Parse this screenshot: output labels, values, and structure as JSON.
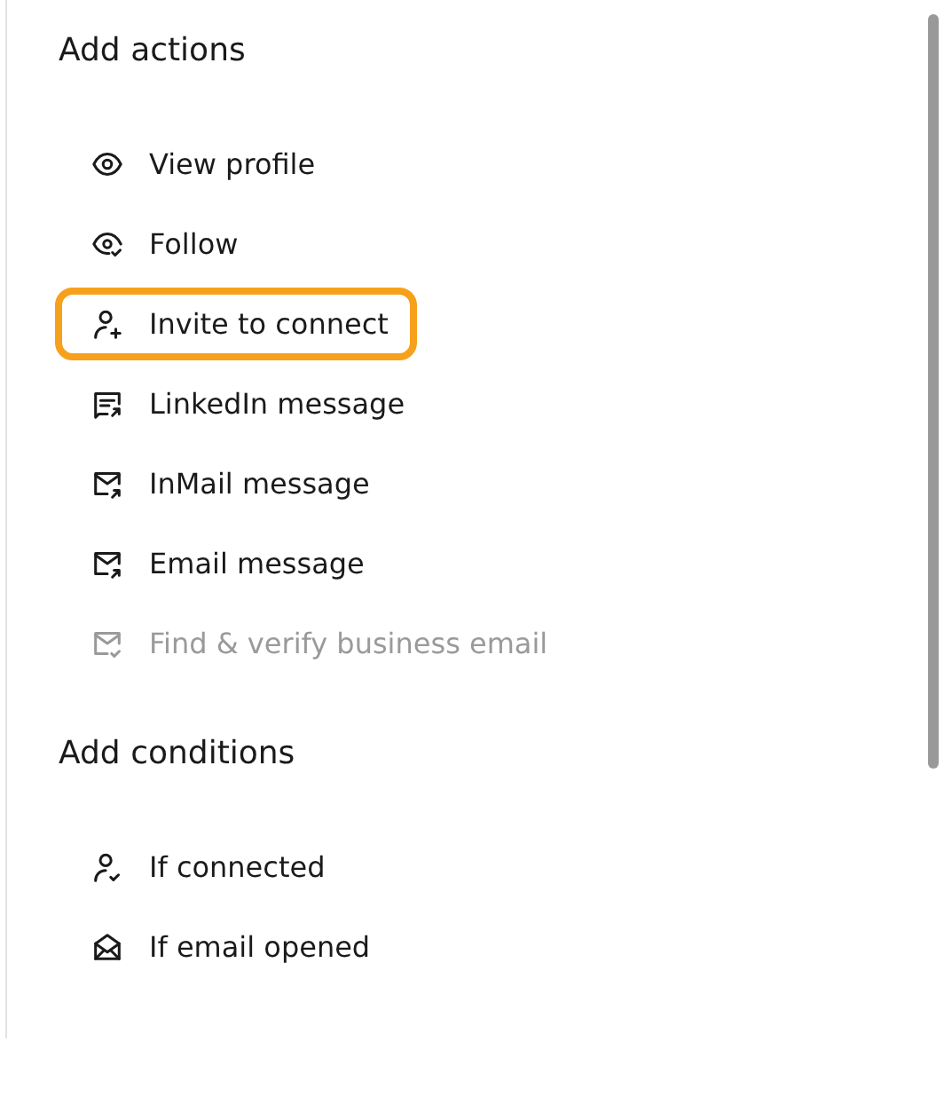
{
  "sections": [
    {
      "title": "Add actions",
      "items": [
        {
          "label": "View profile",
          "disabled": false,
          "highlighted": false
        },
        {
          "label": "Follow",
          "disabled": false,
          "highlighted": false
        },
        {
          "label": "Invite to connect",
          "disabled": false,
          "highlighted": true
        },
        {
          "label": "LinkedIn message",
          "disabled": false,
          "highlighted": false
        },
        {
          "label": "InMail message",
          "disabled": false,
          "highlighted": false
        },
        {
          "label": "Email message",
          "disabled": false,
          "highlighted": false
        },
        {
          "label": "Find & verify business email",
          "disabled": true,
          "highlighted": false
        }
      ]
    },
    {
      "title": "Add conditions",
      "items": [
        {
          "label": "If connected",
          "disabled": false,
          "highlighted": false
        },
        {
          "label": "If email opened",
          "disabled": false,
          "highlighted": false
        }
      ]
    }
  ]
}
